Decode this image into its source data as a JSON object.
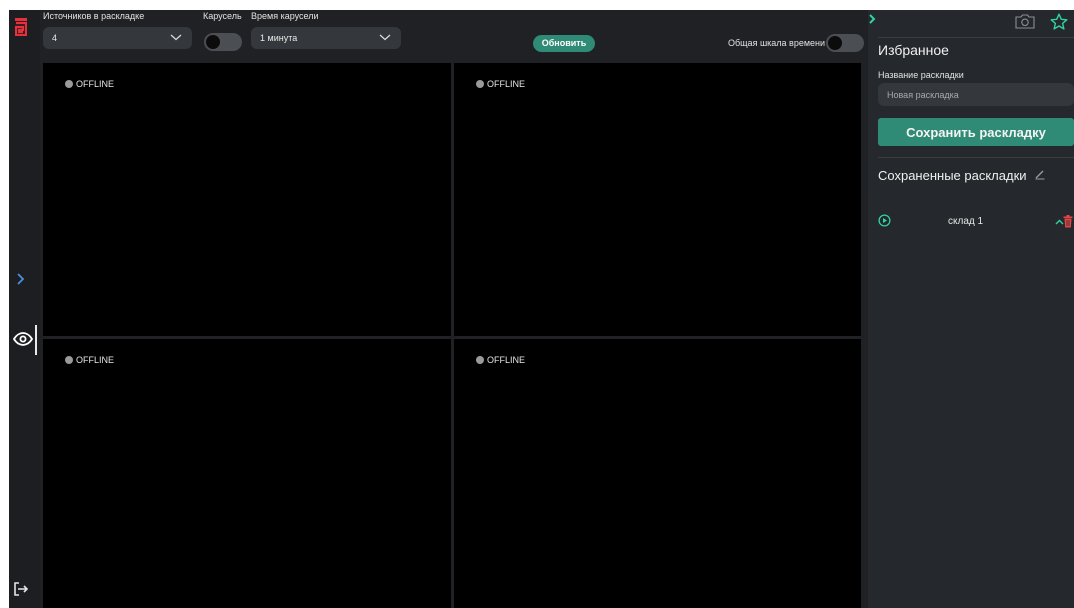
{
  "toolbar": {
    "sources_label": "Источников в раскладке",
    "sources_value": "4",
    "carousel_label": "Карусель",
    "carousel_on": false,
    "carousel_time_label": "Время карусели",
    "carousel_time_value": "1 минута",
    "refresh_label": "Обновить",
    "timeline_label": "Общая шкала времени",
    "timeline_on": false
  },
  "tiles": [
    {
      "status": "OFFLINE"
    },
    {
      "status": "OFFLINE"
    },
    {
      "status": "OFFLINE"
    },
    {
      "status": "OFFLINE"
    }
  ],
  "panel": {
    "title": "Избранное",
    "layout_name_label": "Название раскладки",
    "layout_name_placeholder": "Новая раскладка",
    "save_label": "Сохранить раскладку",
    "saved_title": "Сохраненные раскладки",
    "saved_layouts": [
      {
        "name": "склад 1"
      }
    ]
  },
  "icons": {
    "logo": "app-logo-icon",
    "expand": "chevron-right-icon",
    "view": "eye-icon",
    "logout": "logout-icon",
    "snapshot": "camera-icon",
    "favorite": "star-icon",
    "edit": "pencil-icon",
    "play": "play-circle-icon",
    "collapse": "chevron-up-icon",
    "delete": "trash-icon"
  },
  "colors": {
    "accent": "#2f8a76",
    "accent_bright": "#2fd3a5",
    "danger": "#e84545",
    "logo": "#e8303a",
    "link": "#4a8fe0",
    "background": "#1f2124",
    "video": "#000000",
    "offline_dot": "#9a9a9a"
  }
}
